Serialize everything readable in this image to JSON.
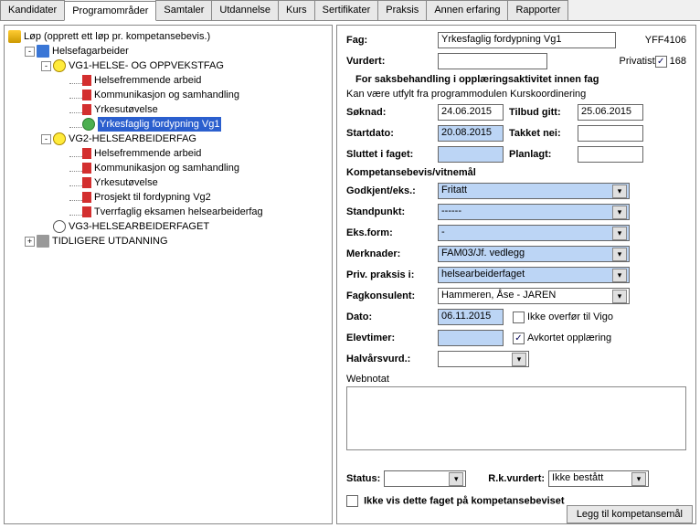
{
  "tabs": {
    "t0": "Kandidater",
    "t1": "Programområder",
    "t2": "Samtaler",
    "t3": "Utdannelse",
    "t4": "Kurs",
    "t5": "Sertifikater",
    "t6": "Praksis",
    "t7": "Annen erfaring",
    "t8": "Rapporter"
  },
  "tree": {
    "root": "Løp (opprett ett løp pr. kompetansebevis.)",
    "n1": "Helsefagarbeider",
    "vg1": "VG1-HELSE- OG OPPVEKSTFAG",
    "vg1_c1": "Helsefremmende arbeid",
    "vg1_c2": "Kommunikasjon og samhandling",
    "vg1_c3": "Yrkesutøvelse",
    "vg1_c4": "Yrkesfaglig fordypning Vg1",
    "vg2": "VG2-HELSEARBEIDERFAG",
    "vg2_c1": "Helsefremmende arbeid",
    "vg2_c2": "Kommunikasjon og samhandling",
    "vg2_c3": "Yrkesutøvelse",
    "vg2_c4": "Prosjekt til fordypning Vg2",
    "vg2_c5": "Tverrfaglig eksamen helsearbeiderfag",
    "vg3": "VG3-HELSEARBEIDERFAGET",
    "tidl": "TIDLIGERE UTDANNING"
  },
  "form": {
    "fag_label": "Fag:",
    "fag_value": "Yrkesfaglig fordypning Vg1",
    "fag_code": "YFF4106",
    "vurdert_label": "Vurdert:",
    "privatist_label": "Privatist",
    "privatist_num": "168",
    "saks_title": "For saksbehandling i opplæringsaktivitet innen fag",
    "saks_sub": "Kan være utfylt fra programmodulen Kurskoordinering",
    "soknad_label": "Søknad:",
    "soknad_value": "24.06.2015",
    "tilbud_label": "Tilbud gitt:",
    "tilbud_value": "25.06.2015",
    "startdato_label": "Startdato:",
    "startdato_value": "20.08.2015",
    "takket_label": "Takket nei:",
    "sluttet_label": "Sluttet i faget:",
    "planlagt_label": "Planlagt:",
    "komp_title": "Kompetansebevis/vitnemål",
    "godkjent_label": "Godkjent/eks.:",
    "godkjent_value": "Fritatt",
    "standpunkt_label": "Standpunkt:",
    "standpunkt_value": "------",
    "eksform_label": "Eks.form:",
    "eksform_value": "-",
    "merknader_label": "Merknader:",
    "merknader_value": "FAM03/Jf. vedlegg",
    "privpraksis_label": "Priv. praksis i:",
    "privpraksis_value": "helsearbeiderfaget",
    "fagkonsulent_label": "Fagkonsulent:",
    "fagkonsulent_value": "Hammeren, Åse - JAREN",
    "dato_label": "Dato:",
    "dato_value": "06.11.2015",
    "ikke_overfor": "Ikke overfør til Vigo",
    "elevtimer_label": "Elevtimer:",
    "avkortet": "Avkortet opplæring",
    "halvars_label": "Halvårsvurd.:",
    "webnotat_label": "Webnotat",
    "status_label": "Status:",
    "rkvurdert_label": "R.k.vurdert:",
    "rkvurdert_value": "Ikke bestått",
    "ikke_vis": "Ikke vis dette faget på kompetansebeviset",
    "legg_btn": "Legg til kompetansemål"
  }
}
